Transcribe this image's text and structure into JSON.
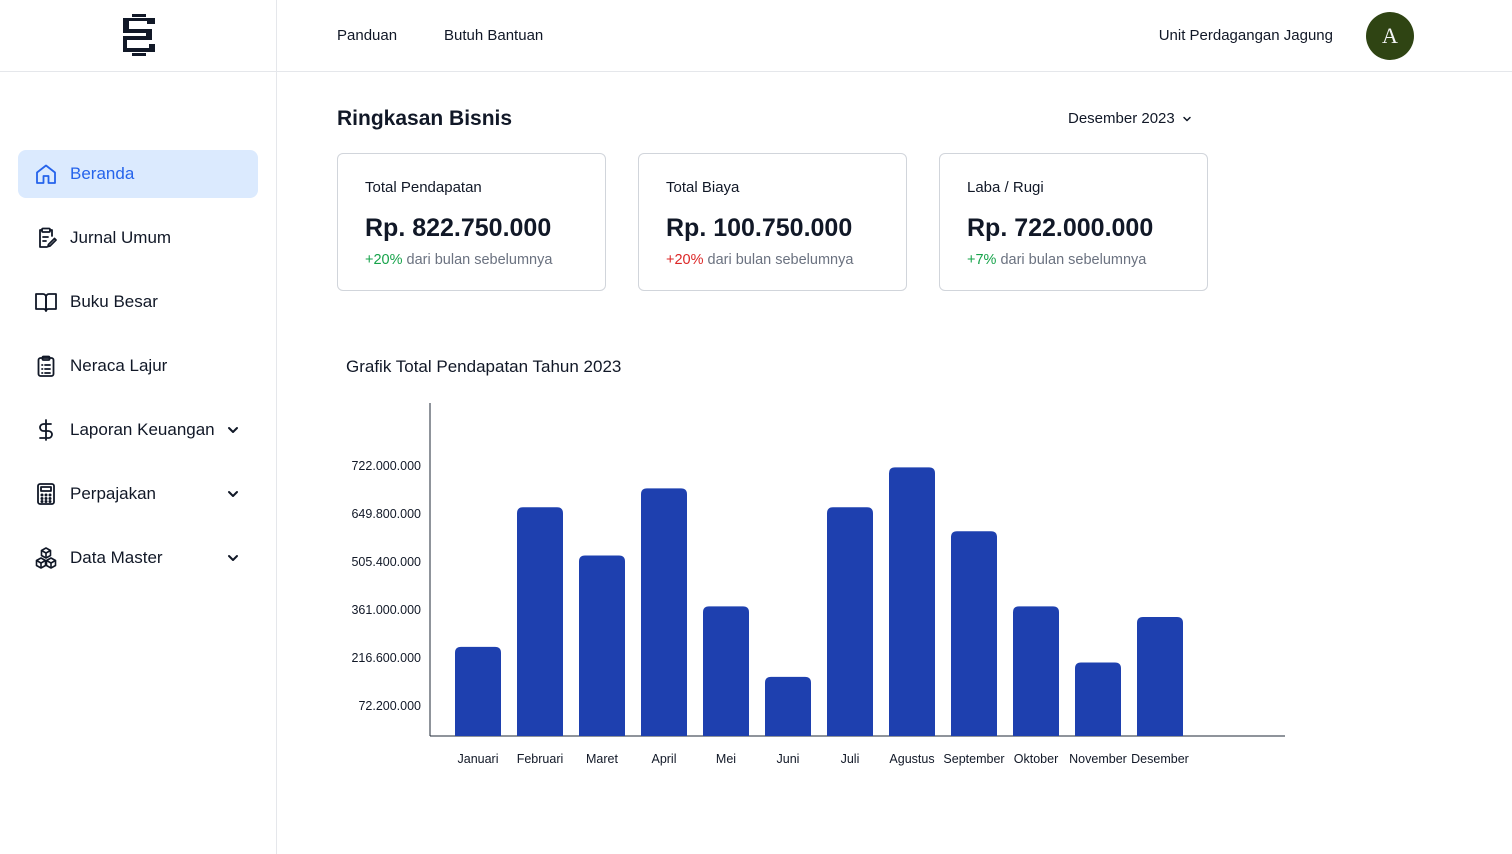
{
  "topbar": {
    "nav": [
      "Panduan",
      "Butuh Bantuan"
    ],
    "org_name": "Unit Perdagangan Jagung",
    "avatar_letter": "A",
    "avatar_color": "#2f4413"
  },
  "sidebar": {
    "items": [
      {
        "label": "Beranda",
        "icon": "home-icon",
        "active": true,
        "has_chevron": false
      },
      {
        "label": "Jurnal Umum",
        "icon": "clipboard-edit-icon",
        "active": false,
        "has_chevron": false
      },
      {
        "label": "Buku Besar",
        "icon": "open-book-icon",
        "active": false,
        "has_chevron": false
      },
      {
        "label": "Neraca Lajur",
        "icon": "clipboard-list-icon",
        "active": false,
        "has_chevron": false
      },
      {
        "label": "Laporan Keuangan",
        "icon": "dollar-icon",
        "active": false,
        "has_chevron": true
      },
      {
        "label": "Perpajakan",
        "icon": "calculator-icon",
        "active": false,
        "has_chevron": true
      },
      {
        "label": "Data Master",
        "icon": "cubes-icon",
        "active": false,
        "has_chevron": true
      }
    ],
    "active_color": "#2563eb",
    "active_bg": "#dbeafe"
  },
  "main": {
    "title": "Ringkasan Bisnis",
    "period": "Desember 2023",
    "cards": [
      {
        "title": "Total Pendapatan",
        "value": "Rp. 822.750.000",
        "change": "+20%",
        "change_color": "green",
        "note": " dari bulan sebelumnya"
      },
      {
        "title": "Total Biaya",
        "value": "Rp. 100.750.000",
        "change": "+20%",
        "change_color": "red",
        "note": " dari bulan sebelumnya"
      },
      {
        "title": "Laba / Rugi",
        "value": "Rp. 722.000.000",
        "change": "+7%",
        "change_color": "green",
        "note": " dari bulan sebelumnya"
      }
    ]
  },
  "chart_data": {
    "type": "bar",
    "title": "Grafik Total Pendapatan Tahun 2023",
    "categories": [
      "Januari",
      "Februari",
      "Maret",
      "April",
      "Mei",
      "Juni",
      "Juli",
      "Agustus",
      "September",
      "Oktober",
      "November",
      "Desember"
    ],
    "values": [
      250000000,
      670000000,
      525000000,
      727000000,
      372000000,
      160000000,
      670000000,
      790000000,
      598000000,
      372000000,
      203000000,
      340000000
    ],
    "y_tick_labels": [
      "72.200.000",
      "216.600.000",
      "361.000.000",
      "505.400.000",
      "649.800.000",
      "722.000.000"
    ],
    "y_tick_values": [
      72200000,
      216600000,
      361000000,
      505400000,
      649800000,
      794200000
    ],
    "bar_color": "#1e40af",
    "grid": false,
    "legend": "none"
  }
}
